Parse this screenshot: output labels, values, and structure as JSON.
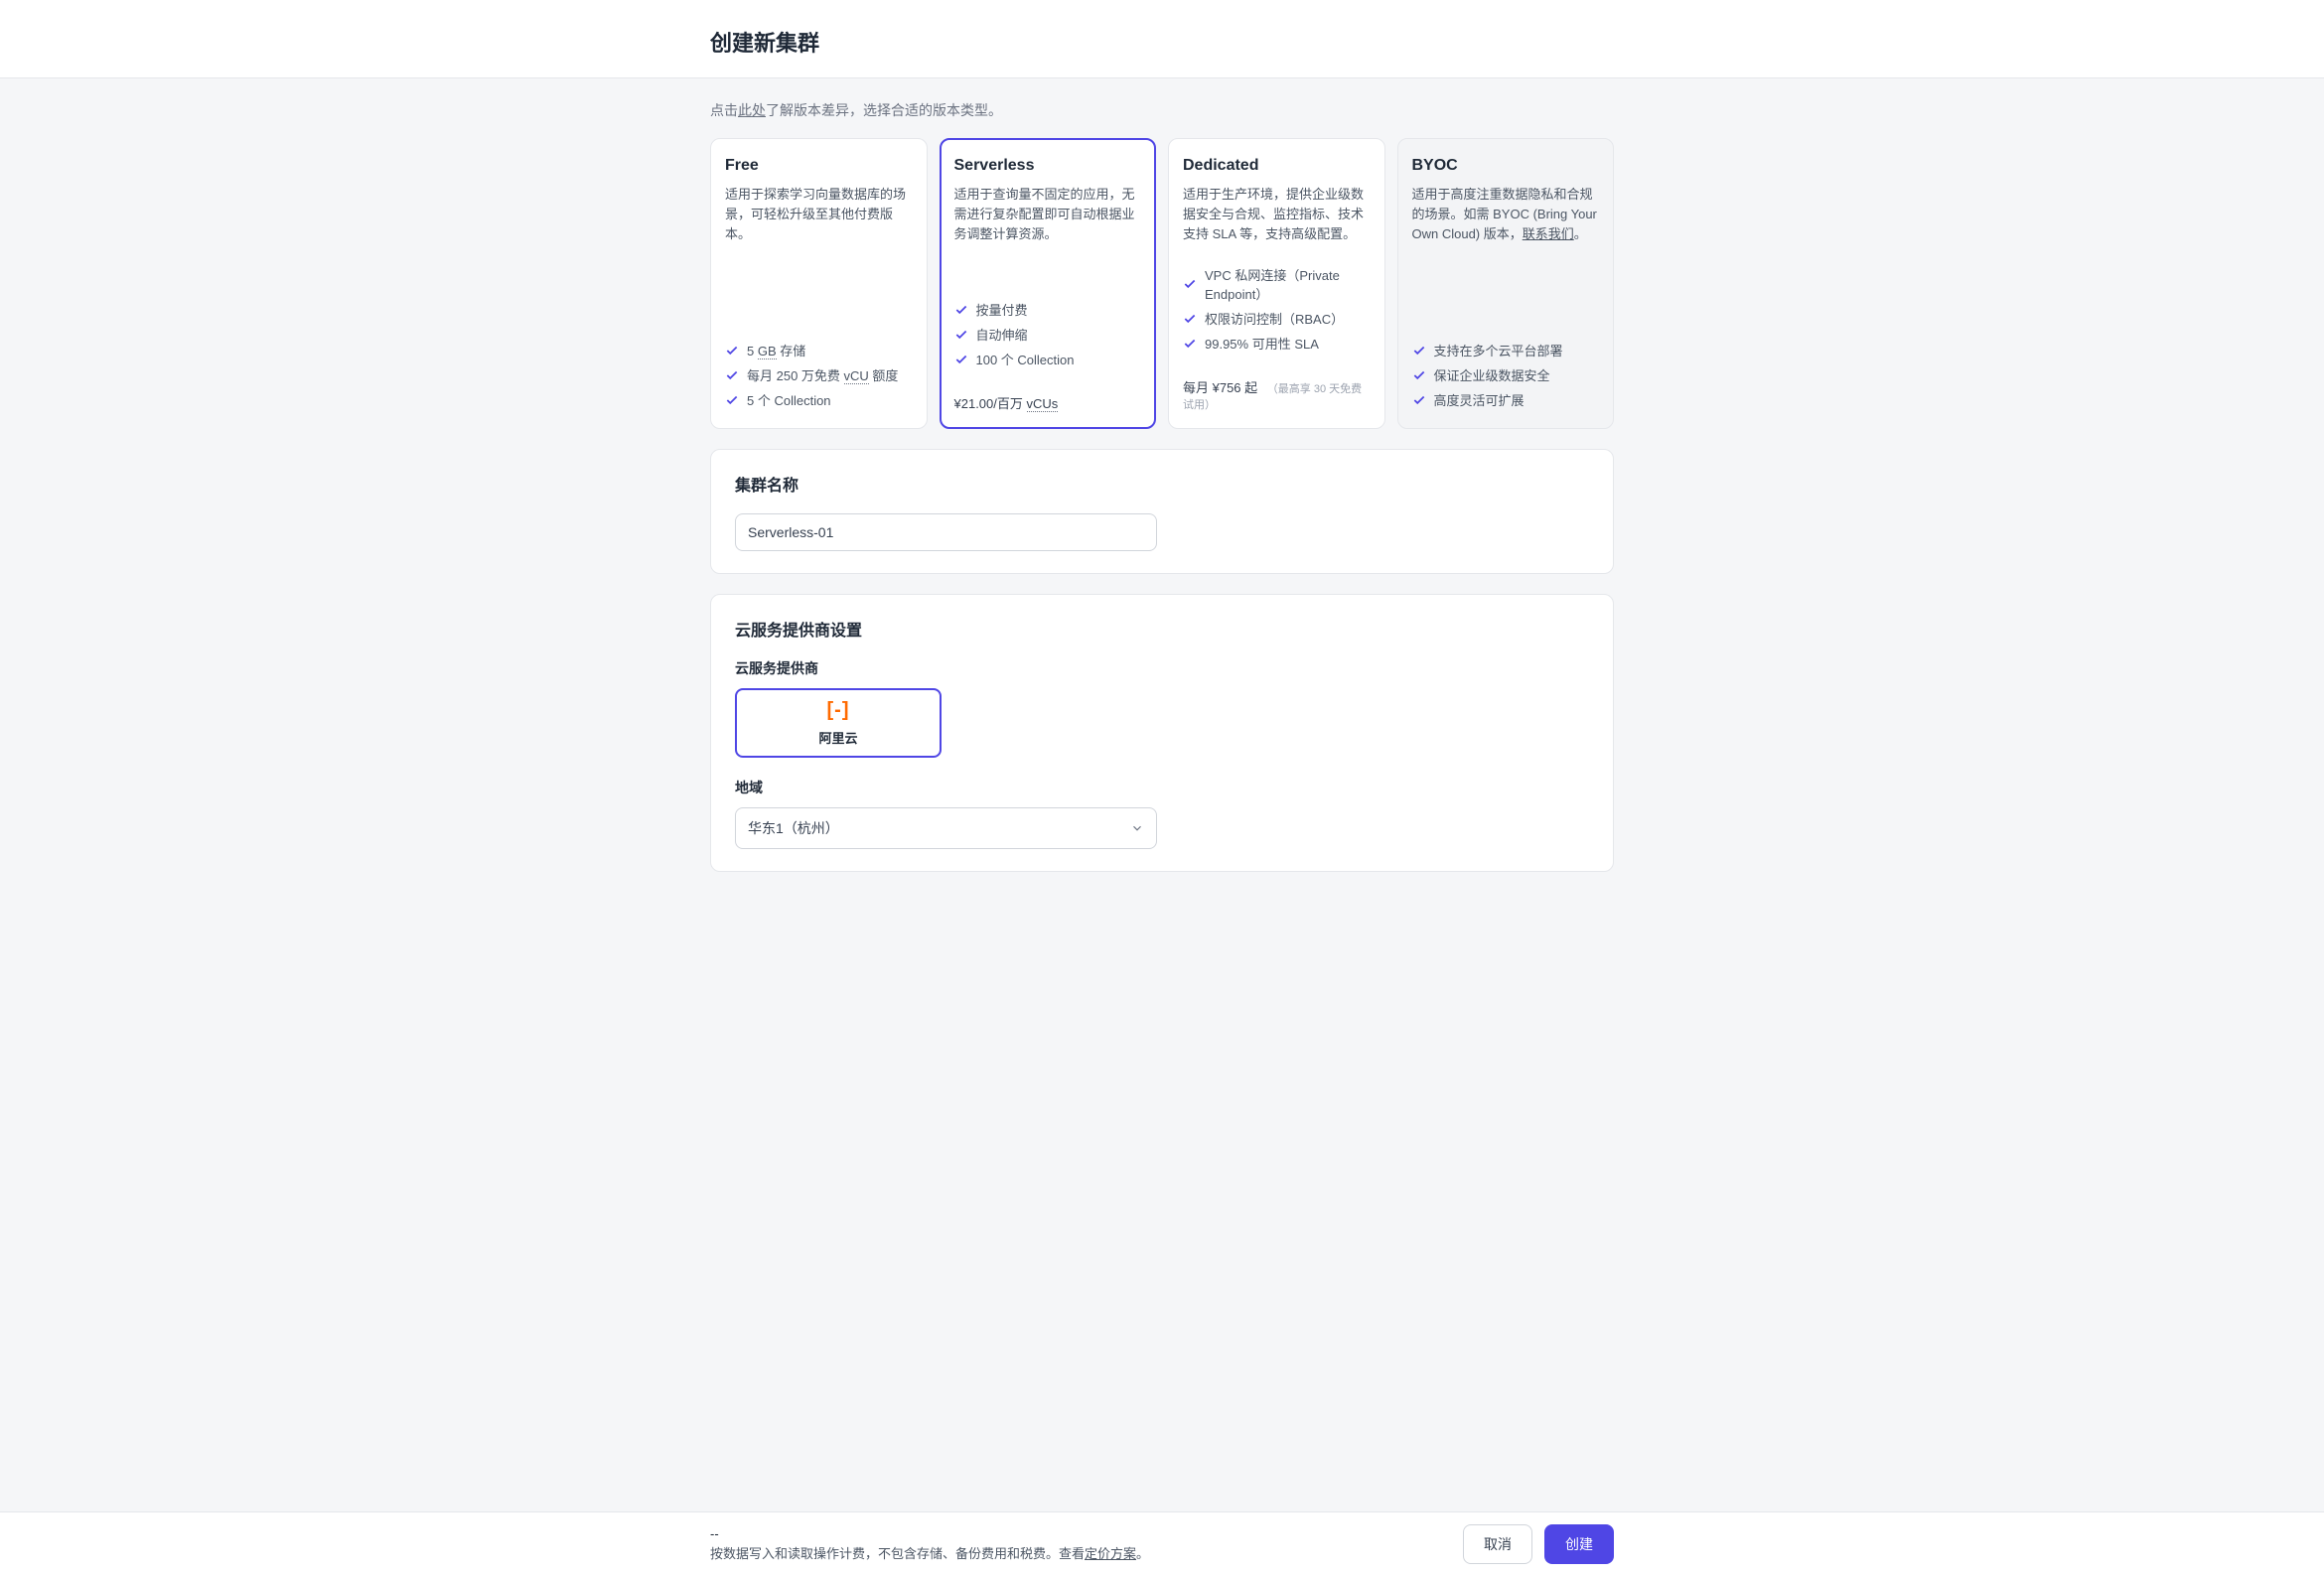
{
  "header": {
    "title": "创建新集群"
  },
  "hint": {
    "prefix": "点击",
    "link": "此处",
    "suffix": "了解版本差异，选择合适的版本类型。"
  },
  "plans": {
    "free": {
      "name": "Free",
      "desc": "适用于探索学习向量数据库的场景，可轻松升级至其他付费版本。",
      "features": [
        {
          "text_before": "5 ",
          "dotted": "GB",
          "text_after": " 存储"
        },
        {
          "text_before": "每月 250 万免费 ",
          "dotted": "vCU",
          "text_after": " 额度"
        },
        {
          "text_before": "5 个 Collection"
        }
      ]
    },
    "serverless": {
      "name": "Serverless",
      "desc": "适用于查询量不固定的应用，无需进行复杂配置即可自动根据业务调整计算资源。",
      "features": [
        {
          "text_before": "按量付费"
        },
        {
          "text_before": "自动伸缩"
        },
        {
          "text_before": "100 个 Collection"
        }
      ],
      "price_before": "¥21.00/百万 ",
      "price_dotted": "vCUs"
    },
    "dedicated": {
      "name": "Dedicated",
      "desc": "适用于生产环境，提供企业级数据安全与合规、监控指标、技术支持 SLA 等，支持高级配置。",
      "features": [
        {
          "text_before": "VPC 私网连接（Private Endpoint）"
        },
        {
          "text_before": "权限访问控制（RBAC）"
        },
        {
          "text_before": "99.95% 可用性 SLA"
        }
      ],
      "price": "每月 ¥756 起",
      "price_note": "（最高享 30 天免费试用）"
    },
    "byoc": {
      "name": "BYOC",
      "desc_before": "适用于高度注重数据隐私和合规的场景。如需 BYOC (Bring Your Own Cloud) 版本，",
      "desc_link": "联系我们",
      "desc_after": "。",
      "features": [
        {
          "text_before": "支持在多个云平台部署"
        },
        {
          "text_before": "保证企业级数据安全"
        },
        {
          "text_before": "高度灵活可扩展"
        }
      ]
    }
  },
  "cluster_name_section": {
    "title": "集群名称",
    "value": "Serverless-01"
  },
  "provider_section": {
    "title": "云服务提供商设置",
    "provider_label": "云服务提供商",
    "provider_name": "阿里云",
    "region_label": "地域",
    "region_value": "华东1（杭州）"
  },
  "footer": {
    "price": "--",
    "note_before": "按数据写入和读取操作计费，不包含存储、备份费用和税费。查看",
    "note_link": "定价方案",
    "note_after": "。",
    "cancel": "取消",
    "create": "创建"
  }
}
